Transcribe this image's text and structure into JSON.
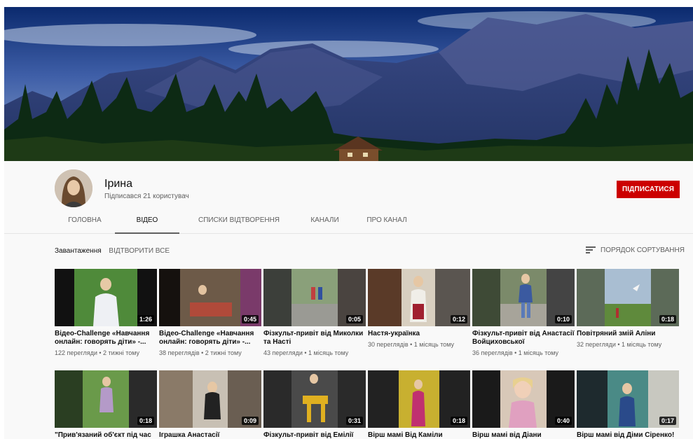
{
  "channel": {
    "name": "Ірина",
    "subscribers": "Підписався 21 користувач",
    "subscribe_label": "ПІДПИСАТИСЯ"
  },
  "tabs": [
    {
      "label": "ГОЛОВНА"
    },
    {
      "label": "ВІДЕО"
    },
    {
      "label": "СПИСКИ ВІДТВОРЕННЯ"
    },
    {
      "label": "КАНАЛИ"
    },
    {
      "label": "ПРО КАНАЛ"
    }
  ],
  "active_tab": "ВІДЕО",
  "toolbar": {
    "section_label": "Завантаження",
    "play_all": "ВІДТВОРИТИ ВСЕ",
    "sort_label": "ПОРЯДОК СОРТУВАННЯ",
    "sort_icon": "sort-icon"
  },
  "videos": [
    {
      "title": "Відео-Challenge «Навчання онлайн: говорять діти» -...",
      "meta": "122 перегляди • 2 тижні тому",
      "duration": "1:26"
    },
    {
      "title": "Відео-Challenge «Навчання онлайн: говорять діти» -...",
      "meta": "38 переглядів • 2 тижні тому",
      "duration": "0:45"
    },
    {
      "title": "Фізкульт-привіт від Миколки та Насті",
      "meta": "43 перегляди • 1 місяць тому",
      "duration": "0:05"
    },
    {
      "title": "Настя-українка",
      "meta": "30 переглядів • 1 місяць тому",
      "duration": "0:12"
    },
    {
      "title": "Фізкульт-привіт від Анастасії Войциховської",
      "meta": "36 переглядів • 1 місяць тому",
      "duration": "0:10"
    },
    {
      "title": "Повітряний змій Аліни",
      "meta": "32 перегляди • 1 місяць тому",
      "duration": "0:18"
    },
    {
      "title": "\"Прив'язаний об'єкт під час",
      "meta": "",
      "duration": "0:18"
    },
    {
      "title": "Іграшка Анастасії",
      "meta": "",
      "duration": "0:09"
    },
    {
      "title": "Фізкульт-привіт від Емілії",
      "meta": "",
      "duration": "0:31"
    },
    {
      "title": "Вірш мамі Від Каміли",
      "meta": "",
      "duration": "0:18"
    },
    {
      "title": "Вірш мамі від Діани",
      "meta": "",
      "duration": "0:40"
    },
    {
      "title": "Вірш мамі від Діми Сіренко!",
      "meta": "",
      "duration": "0:17"
    }
  ],
  "colors": {
    "subscribe": "#cc0000",
    "text_secondary": "#606060",
    "background": "#f9f9f9"
  }
}
